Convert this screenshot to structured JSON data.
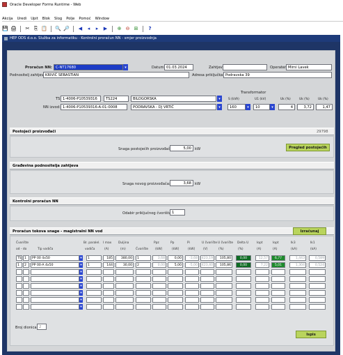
{
  "window": {
    "title": "Oracle Developer Forms Runtime - Web"
  },
  "menu": [
    "Akcija",
    "Uredi",
    "Upit",
    "Blok",
    "Slog",
    "Polje",
    "Pomoć",
    "Window"
  ],
  "form_header": "HEP ODS d.o.o. Služba za informatiku - Kontrolni proračun NN - smjer proizvodnja",
  "top": {
    "proracun_label": "Proračun NN:",
    "proracun_value": "C-NT17680",
    "datum_label": "Datum:",
    "datum_value": "01.03.2024",
    "zahtjev_label": "Zahtjev:",
    "zahtjev_value": "",
    "operater_label": "Operater",
    "operater_value": "Mirni Lavek",
    "podnositelj_label": "Podnositelj zahtjeva",
    "podnositelj_value": "KRIVIĆ SEBASTIAN",
    "adresa_label": "Adresa priključka",
    "adresa_value": "Podravska 39"
  },
  "ts": {
    "ts_label": "TS:",
    "ts_value": "1-4006-P10539316",
    "ts_code": "TS224",
    "ts_name": "BILOGORSKA",
    "nn_label": "NN izvod:",
    "nn_value": "1-4006-P10539316-A-01-0008",
    "nn_name": "PODRAVSKA - DJ VRTIĆ",
    "transformator_label": "Transformator",
    "tr_cols": [
      "S (kVA)",
      "U1 (kV)",
      "Uk (%)",
      "Uk (%)",
      "Uk (%)"
    ],
    "tr_values": [
      "160",
      "10",
      "4",
      "3,72",
      "1,47"
    ]
  },
  "sections": {
    "postojeci_title": "Postojeći proizvođači",
    "postojeci_count": "29798",
    "snaga_postojecih_label": "Snaga postojećih proizvođača:",
    "snaga_postojecih_value": "5,00",
    "snaga_unit": "kW",
    "pregled_button": "Pregled postojećih",
    "gradjevina_title": "Građevina podnositelja zahtjeva",
    "snaga_novog_label": "Snaga novog proizvođača:",
    "snaga_novog_value": "3,68",
    "kontrolni_title": "Kontrolni proračun NN",
    "odabir_label": "Odabir priključnog čvorišta:",
    "odabir_value": "1",
    "tokovi_title": "Proračun tokova snage - magistralni NN vod",
    "izracunaj_button": "Izračunaj",
    "ispis_button": "Ispis"
  },
  "table": {
    "headers_top": [
      "Čvorište",
      "",
      "Br. paralel.",
      "I max",
      "Duljina",
      "",
      "Ppz",
      "Pp",
      "Pi",
      "U čvorište",
      "U čvorište",
      "Delta U",
      "Iopt",
      "Iopt",
      "Ik3",
      "Ik1"
    ],
    "headers_bot": [
      "od - do",
      "Tip vodiča",
      "vodiča",
      "(A)",
      "(m)",
      "Čvorište",
      "(kW)",
      "(kW)",
      "(kW)",
      "(V)",
      "(%)",
      "(%)",
      "(A)",
      "(A)",
      "(kA)",
      "(kA)"
    ],
    "rows": [
      {
        "od": "TS",
        "do": "1",
        "tip": "PP 00 4x50",
        "br": "1",
        "imax": "185",
        "duljina": "380,00",
        "cvor": "1",
        "ppz": "3,68",
        "pp": "0,00",
        "pi": "-3,68",
        "uv": "423,19",
        "up": "105,80",
        "du": "0,00",
        "iopt1": "12,57",
        "iopt2": "6,77",
        "ik3": "1,443",
        "ik1": "0,589"
      },
      {
        "od": "1",
        "do": "2",
        "tip": "PP 00-A 4x50",
        "br": "1",
        "imax": "144",
        "duljina": "30,00",
        "cvor": "2",
        "ppz": "0,00",
        "pp": "5,00",
        "pi": "-5,00",
        "uv": "423,40",
        "up": "105,86",
        "du": "0,00",
        "iopt1": "7,22",
        "iopt2": "5,01",
        "ik3": "1,304",
        "ik1": "0,524"
      }
    ],
    "empty_rows": 6,
    "broj_dionica_label": "Broj dionica:",
    "broj_dionica_value": "2"
  }
}
